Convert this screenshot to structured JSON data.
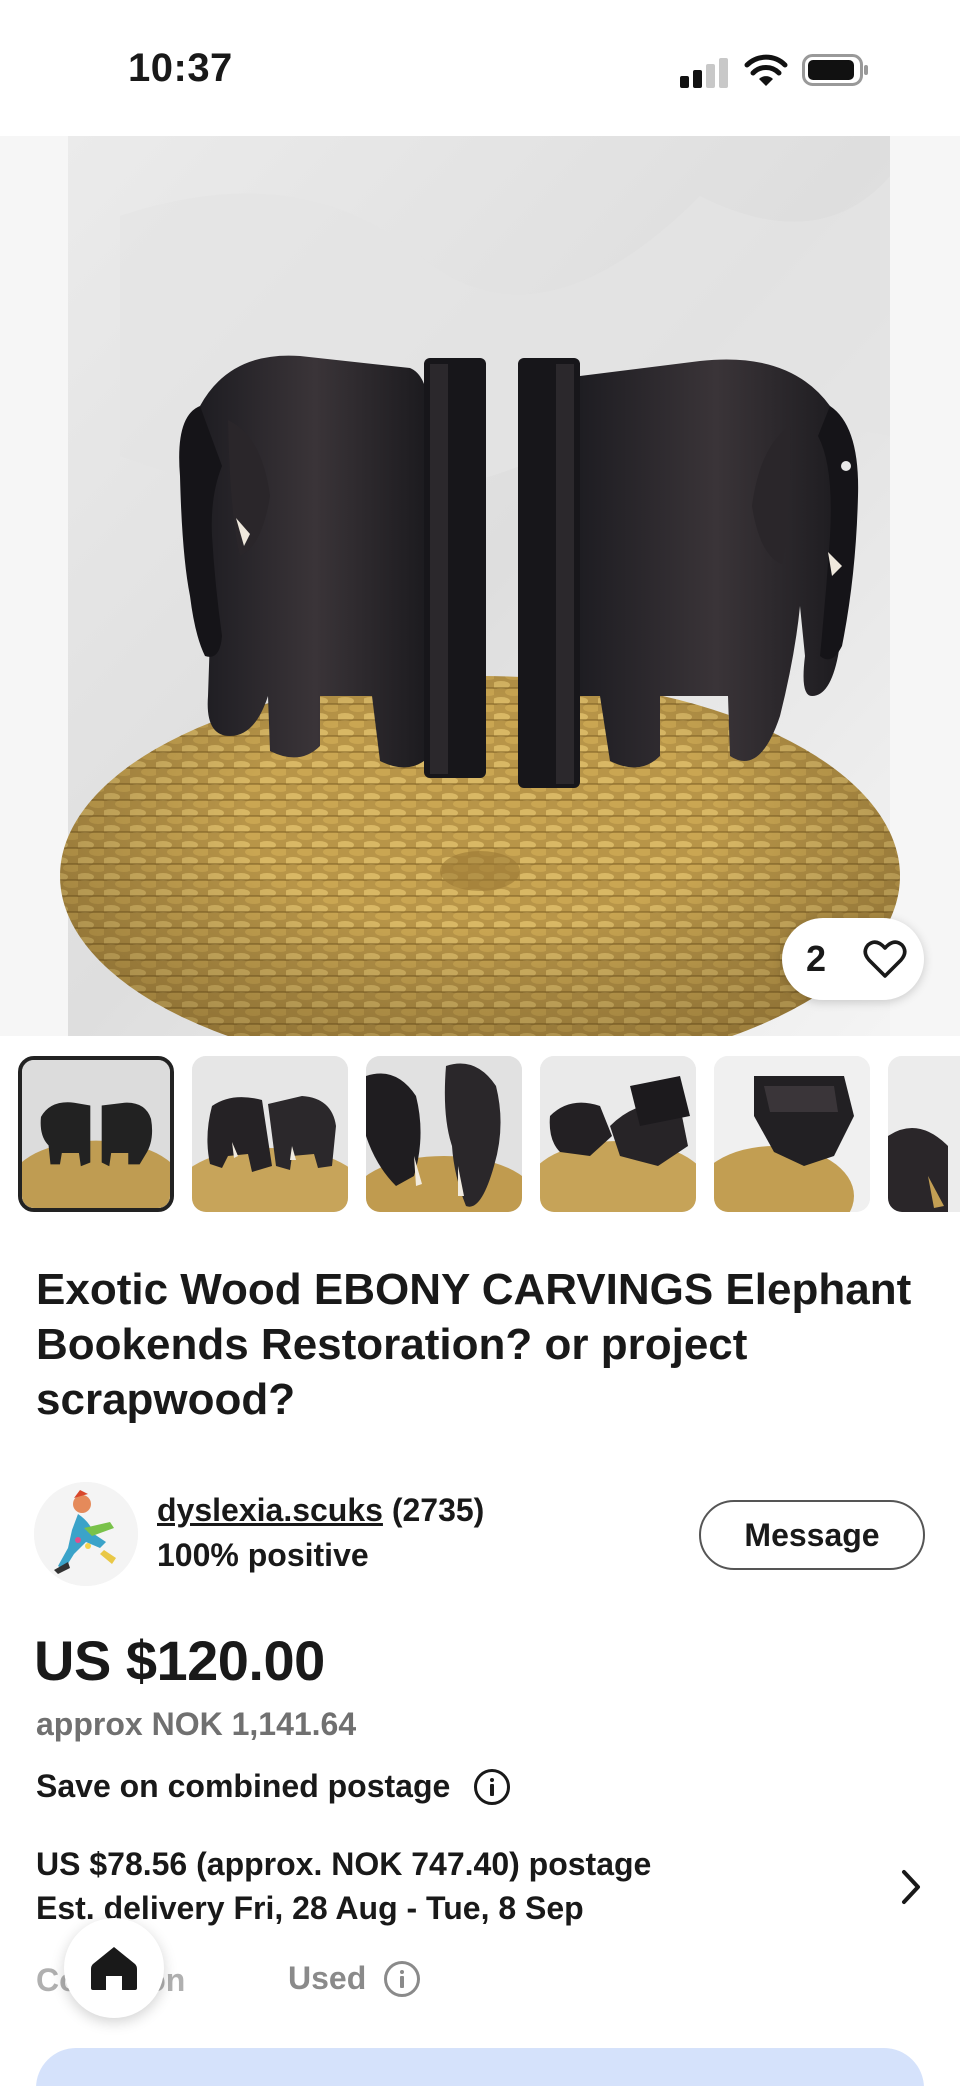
{
  "status_bar": {
    "time": "10:37",
    "icons": [
      "cellular-signal-icon",
      "wifi-icon",
      "battery-icon"
    ]
  },
  "gallery": {
    "like_count": "2",
    "like_icon": "heart-outline-icon",
    "thumbnail_count_visible": 6,
    "selected_index": 0
  },
  "listing": {
    "title": "Exotic Wood EBONY CARVINGS Elephant Bookends Restoration? or project scrapwood?"
  },
  "seller": {
    "name": "dyslexia.scuks",
    "feedback_count": "(2735)",
    "positive": "100% positive",
    "message_label": "Message"
  },
  "price": {
    "amount": "US $120.00",
    "approx": "approx NOK 1,141.64",
    "combined_postage": "Save on combined postage"
  },
  "shipping": {
    "postage": "US $78.56 (approx. NOK 747.40) postage",
    "delivery": "Est. delivery Fri, 28 Aug - Tue, 8 Sep"
  },
  "condition": {
    "label": "Condition",
    "value": "Used"
  },
  "colors": {
    "text": "#191919",
    "muted": "#707070",
    "buy_button_bg": "#d5e2fb"
  }
}
